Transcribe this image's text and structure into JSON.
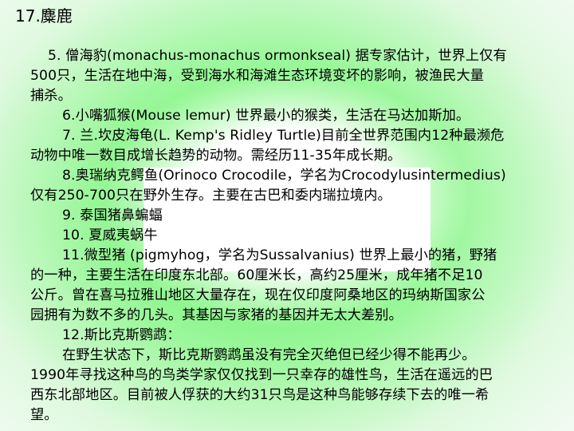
{
  "slide": {
    "title": "17.麋鹿"
  },
  "lines": [
    "5. 僧海豹(monachus-monachus ormonkseal) 据专家估计，世界上仅有",
    "500只，生活在地中海，受到海水和海滩生态环境变坏的影响，被渔民大量",
    "捕杀。",
    "6.小嘴狐猴(Mouse lemur) 世界最小的猴类，生活在马达加斯加。",
    "7. 兰.坎皮海龟(L. Kemp's Ridley Turtle)目前全世界范围内12种最濒危",
    "动物中唯一数目成增长趋势的动物。需经历11-35年成长期。",
    "8.奥瑞纳克鳄鱼(Orinoco Crocodile，学名为Crocodylusintermedius)",
    "仅有250-700只在野外生存。主要在古巴和委内瑞拉境内。",
    "9. 泰国猪鼻蝙蝠",
    "10. 夏威夷蜗牛",
    "11.微型猪  (pigmyhog，学名为Sussalvanius) 世界上最小的猪，野猪",
    "的一种，主要生活在印度东北部。60厘米长，高约25厘米，成年猪不足10",
    "公斤。曾在喜马拉雅山地区大量存在，现在仅印度阿桑地区的玛纳斯国家公",
    "园拥有为数不多的几头。其基因与家猪的基因并无太大差别。",
    "12.斯比克斯鹦鹉：",
    "在野生状态下，斯比克斯鹦鹉虽没有完全灭绝但已经少得不能再少。",
    "1990年寻找这种鸟的鸟类学家仅仅找到一只幸存的雄性鸟，生活在遥远的巴",
    "西东北部地区。目前被人俘获的大约31只鸟是这种鸟能够存续下去的唯一希",
    "望。"
  ]
}
